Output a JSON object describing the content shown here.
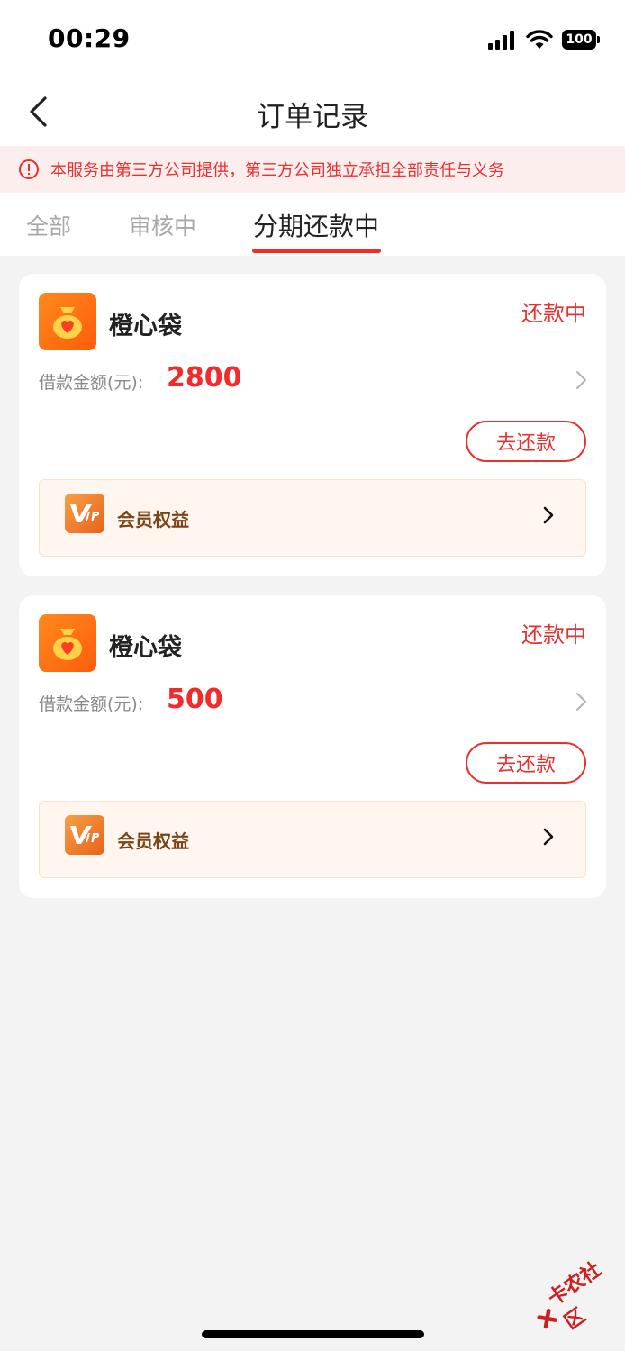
{
  "status_bar": {
    "time": "00:29",
    "battery": "100"
  },
  "nav": {
    "title": "订单记录"
  },
  "notice": {
    "text": "本服务由第三方公司提供，第三方公司独立承担全部责任与义务"
  },
  "tabs": [
    {
      "label": "全部"
    },
    {
      "label": "审核中"
    },
    {
      "label": "分期还款中"
    }
  ],
  "orders": [
    {
      "brand": "橙心袋",
      "status": "还款中",
      "amount_label": "借款金额(元):",
      "amount": "2800",
      "repay_button": "去还款",
      "vip_label": "会员权益"
    },
    {
      "brand": "橙心袋",
      "status": "还款中",
      "amount_label": "借款金额(元):",
      "amount": "500",
      "repay_button": "去还款",
      "vip_label": "会员权益"
    }
  ],
  "watermark": {
    "text": "卡农社区"
  },
  "colors": {
    "accent": "#e8302f",
    "brand_orange": "#ff6a13",
    "vip_text": "#7a4418"
  }
}
